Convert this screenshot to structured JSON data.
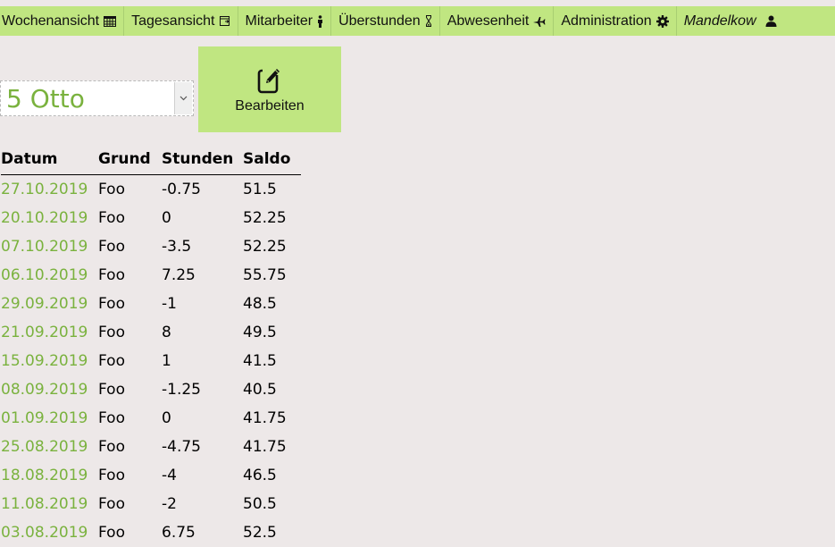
{
  "nav": {
    "items": [
      {
        "label": "Wochenansicht",
        "icon": "calendar-grid-icon"
      },
      {
        "label": "Tagesansicht",
        "icon": "calendar-day-icon"
      },
      {
        "label": "Mitarbeiter",
        "icon": "person-icon"
      },
      {
        "label": "Überstunden",
        "icon": "hourglass-icon"
      },
      {
        "label": "Abwesenheit",
        "icon": "plane-icon"
      },
      {
        "label": "Administration",
        "icon": "gear-icon"
      }
    ],
    "user": {
      "label": "Mandelkow",
      "icon": "user-icon"
    }
  },
  "employee_select": {
    "value": "5 Otto"
  },
  "edit_button": {
    "label": "Bearbeiten",
    "icon": "edit-icon"
  },
  "table": {
    "headers": [
      "Datum",
      "Grund",
      "Stunden",
      "Saldo"
    ],
    "rows": [
      [
        "27.10.2019",
        "Foo",
        "-0.75",
        "51.5"
      ],
      [
        "20.10.2019",
        "Foo",
        "0",
        "52.25"
      ],
      [
        "07.10.2019",
        "Foo",
        "-3.5",
        "52.25"
      ],
      [
        "06.10.2019",
        "Foo",
        "7.25",
        "55.75"
      ],
      [
        "29.09.2019",
        "Foo",
        "-1",
        "48.5"
      ],
      [
        "21.09.2019",
        "Foo",
        "8",
        "49.5"
      ],
      [
        "15.09.2019",
        "Foo",
        "1",
        "41.5"
      ],
      [
        "08.09.2019",
        "Foo",
        "-1.25",
        "40.5"
      ],
      [
        "01.09.2019",
        "Foo",
        "0",
        "41.75"
      ],
      [
        "25.08.2019",
        "Foo",
        "-4.75",
        "41.75"
      ],
      [
        "18.08.2019",
        "Foo",
        "-4",
        "46.5"
      ],
      [
        "11.08.2019",
        "Foo",
        "-2",
        "50.5"
      ],
      [
        "03.08.2019",
        "Foo",
        "6.75",
        "52.5"
      ]
    ]
  },
  "colors": {
    "accent": "#c0e681",
    "date_text": "#7ab23e",
    "background": "#ede8e8"
  }
}
